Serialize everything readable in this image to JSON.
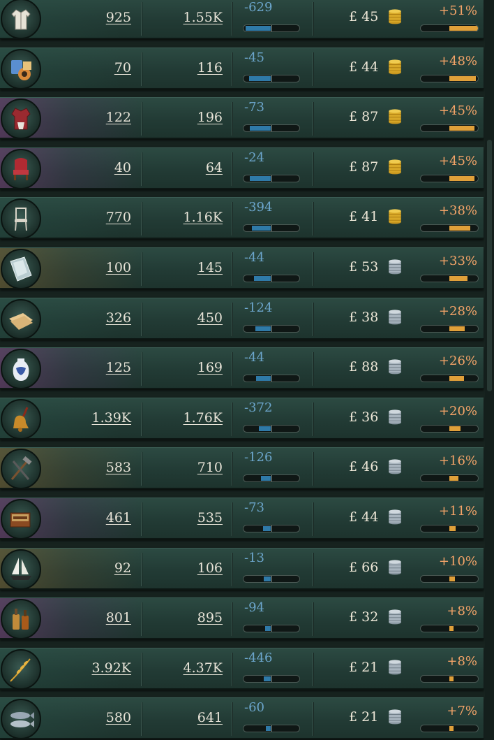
{
  "rows": [
    {
      "good": "clothes-icon",
      "tint": "green",
      "supply": "925",
      "demand": "1.55K",
      "balance": "-629",
      "balance_fill": 0.45,
      "price": "£ 45",
      "currency": "gold",
      "pct": "+51%",
      "pct_fill": 0.51
    },
    {
      "good": "groceries-icon",
      "tint": "green",
      "supply": "70",
      "demand": "116",
      "balance": "-45",
      "balance_fill": 0.39,
      "price": "£ 44",
      "currency": "gold",
      "pct": "+48%",
      "pct_fill": 0.48
    },
    {
      "good": "luxury-clothes-icon",
      "tint": "purple",
      "supply": "122",
      "demand": "196",
      "balance": "-73",
      "balance_fill": 0.37,
      "price": "£ 87",
      "currency": "gold",
      "pct": "+45%",
      "pct_fill": 0.45
    },
    {
      "good": "luxury-furniture-icon",
      "tint": "purple",
      "supply": "40",
      "demand": "64",
      "balance": "-24",
      "balance_fill": 0.37,
      "price": "£ 87",
      "currency": "gold",
      "pct": "+45%",
      "pct_fill": 0.45
    },
    {
      "good": "furniture-icon",
      "tint": "green",
      "supply": "770",
      "demand": "1.16K",
      "balance": "-394",
      "balance_fill": 0.34,
      "price": "£ 41",
      "currency": "gold",
      "pct": "+38%",
      "pct_fill": 0.38
    },
    {
      "good": "glass-icon",
      "tint": "brown",
      "supply": "100",
      "demand": "145",
      "balance": "-44",
      "balance_fill": 0.3,
      "price": "£ 53",
      "currency": "silver",
      "pct": "+33%",
      "pct_fill": 0.33
    },
    {
      "good": "paper-icon",
      "tint": "green",
      "supply": "326",
      "demand": "450",
      "balance": "-124",
      "balance_fill": 0.28,
      "price": "£ 38",
      "currency": "silver",
      "pct": "+28%",
      "pct_fill": 0.28
    },
    {
      "good": "porcelain-icon",
      "tint": "purple",
      "supply": "125",
      "demand": "169",
      "balance": "-44",
      "balance_fill": 0.26,
      "price": "£ 88",
      "currency": "silver",
      "pct": "+26%",
      "pct_fill": 0.26
    },
    {
      "good": "services-bell-icon",
      "tint": "green",
      "supply": "1.39K",
      "demand": "1.76K",
      "balance": "-372",
      "balance_fill": 0.21,
      "price": "£ 36",
      "currency": "silver",
      "pct": "+20%",
      "pct_fill": 0.2
    },
    {
      "good": "tools-icon",
      "tint": "brown",
      "supply": "583",
      "demand": "710",
      "balance": "-126",
      "balance_fill": 0.18,
      "price": "£ 46",
      "currency": "silver",
      "pct": "+16%",
      "pct_fill": 0.16
    },
    {
      "good": "tobacco-box-icon",
      "tint": "purple",
      "supply": "461",
      "demand": "535",
      "balance": "-73",
      "balance_fill": 0.14,
      "price": "£ 44",
      "currency": "silver",
      "pct": "+11%",
      "pct_fill": 0.11
    },
    {
      "good": "clipper-ship-icon",
      "tint": "brown",
      "supply": "92",
      "demand": "106",
      "balance": "-13",
      "balance_fill": 0.12,
      "price": "£ 66",
      "currency": "silver",
      "pct": "+10%",
      "pct_fill": 0.1
    },
    {
      "good": "liquor-bottles-icon",
      "tint": "purple",
      "supply": "801",
      "demand": "895",
      "balance": "-94",
      "balance_fill": 0.1,
      "price": "£ 32",
      "currency": "silver",
      "pct": "+8%",
      "pct_fill": 0.08
    },
    {
      "good": "grain-icon",
      "tint": "green",
      "supply": "3.92K",
      "demand": "4.37K",
      "balance": "-446",
      "balance_fill": 0.12,
      "price": "£ 21",
      "currency": "silver",
      "pct": "+8%",
      "pct_fill": 0.08
    },
    {
      "good": "fish-icon",
      "tint": "green",
      "supply": "580",
      "demand": "641",
      "balance": "-60",
      "balance_fill": 0.09,
      "price": "£ 21",
      "currency": "silver",
      "pct": "+7%",
      "pct_fill": 0.07
    }
  ],
  "colors": {
    "balance_text": "#6ca6cc",
    "pct_text": "#f4a468",
    "balance_bar": "#2f7aa8",
    "pct_bar": "#e0a03a"
  }
}
